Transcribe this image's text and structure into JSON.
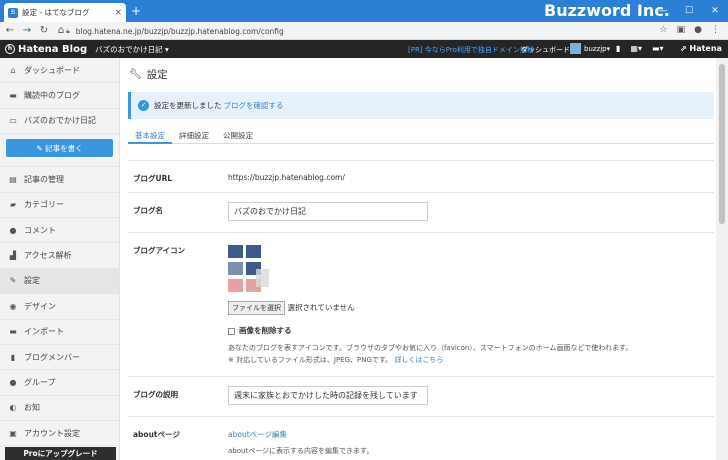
{
  "browser": {
    "tab_title": "設定 - はてなブログ",
    "tab_close": "×",
    "new_tab": "+",
    "watermark": "Buzzword Inc.",
    "url": "blog.hatena.ne.jp/buzzjp/buzzjp.hatenablog.com/config",
    "window_buttons": [
      "—",
      "☐",
      "✕"
    ]
  },
  "header": {
    "logo_text": "Hatena Blog",
    "blog_selector": "バズのおでかけ日記",
    "pro_promo": "[PR] 今ならPro利用で独自ドメイン無料",
    "dashboard": "ダッシュボード",
    "username": "buzzjp",
    "hatena": "Hatena"
  },
  "sidebar": {
    "items_top": [
      {
        "label": "ダッシュボード",
        "icon": "home-icon",
        "glyph": "⌂"
      },
      {
        "label": "購読中のブログ",
        "icon": "feed-icon",
        "glyph": "▬"
      },
      {
        "label": "バズのおでかけ日記",
        "icon": "blog-icon",
        "glyph": "▭"
      }
    ],
    "write_button": "記事を書く",
    "items": [
      {
        "label": "記事の管理",
        "icon": "list-icon",
        "glyph": "▤"
      },
      {
        "label": "カテゴリー",
        "icon": "folder-icon",
        "glyph": "▰"
      },
      {
        "label": "コメント",
        "icon": "comment-icon",
        "glyph": "●"
      },
      {
        "label": "アクセス解析",
        "icon": "chart-icon",
        "glyph": "▟"
      },
      {
        "label": "設定",
        "icon": "wrench-icon",
        "glyph": "✎",
        "active": true
      },
      {
        "label": "デザイン",
        "icon": "design-icon",
        "glyph": "◉"
      },
      {
        "label": "インポート",
        "icon": "import-icon",
        "glyph": "▬"
      },
      {
        "label": "ブログメンバー",
        "icon": "members-icon",
        "glyph": "▮"
      },
      {
        "label": "グループ",
        "icon": "group-icon",
        "glyph": "●"
      },
      {
        "label": "お知",
        "icon": "notice-icon",
        "glyph": "◐"
      },
      {
        "label": "アカウント設定",
        "icon": "account-icon",
        "glyph": "▣"
      }
    ],
    "pro_button": "Proにアップグレード"
  },
  "main": {
    "title": "設定",
    "notice": {
      "text": "設定を更新しました",
      "link": "ブログを確認する"
    },
    "tabs": [
      "基本設定",
      "詳細設定",
      "公開設定"
    ],
    "blog_url": {
      "label": "ブログURL",
      "value": "https://buzzjp.hatenablog.com/"
    },
    "blog_name": {
      "label": "ブログ名",
      "value": "バズのおでかけ日記"
    },
    "blog_icon": {
      "label": "ブログアイコン",
      "file_button": "ファイルを選択",
      "file_status": "選択されていません",
      "delete_label": "画像を削除する",
      "help": "あなたのブログを表すアイコンです。ブラウザのタブやお気に入り（favicon）、スマートフォンのホーム画面などで使われます。",
      "formats": "※ 対応しているファイル形式は、JPEG、PNGです。",
      "formats_link": "詳しくはこちら"
    },
    "blog_description": {
      "label": "ブログの説明",
      "value": "週末に家族とおでかけした時の記録を残しています"
    },
    "about": {
      "label": "aboutページ",
      "link": "aboutページ編集",
      "help": "aboutページに表示する内容を編集できます。"
    }
  }
}
